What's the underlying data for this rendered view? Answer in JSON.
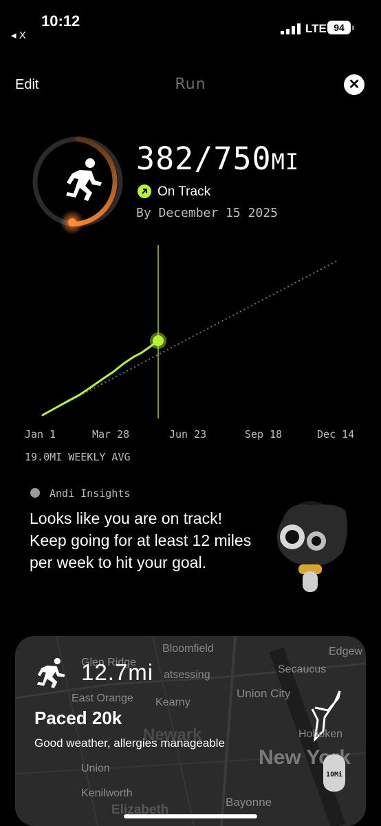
{
  "status_bar": {
    "time": "10:12",
    "back_app": "◂ X",
    "carrier": "LTE",
    "battery": "94"
  },
  "header": {
    "edit_label": "Edit",
    "title": "Run",
    "close_glyph": "✕"
  },
  "goal": {
    "current": "382",
    "target": "/750",
    "unit": "MI",
    "progress_fraction": 0.51,
    "status": "On Track",
    "deadline": "By December 15 2025"
  },
  "chart_data": {
    "type": "line",
    "x_ticks": [
      "Jan 1",
      "Mar 28",
      "Jun 23",
      "Sep 18",
      "Dec 14"
    ],
    "series": [
      {
        "values_fraction_of_year": [
          0.0,
          0.05,
          0.1,
          0.15,
          0.2,
          0.25,
          0.3,
          0.35,
          0.4,
          0.45
        ],
        "miles": [
          0,
          40,
          75,
          115,
          155,
          200,
          250,
          310,
          355,
          382
        ]
      }
    ],
    "projection_end_miles": 750,
    "today_marker": "today"
  },
  "weekly_avg": "19.0MI WEEKLY AVG",
  "insights": {
    "label": "Andi Insights",
    "text": "Looks like you are on track! Keep going for at least 12 miles per week to hit your goal."
  },
  "activity": {
    "distance": "12.7mi",
    "title": "Paced 20k",
    "subtitle": "Good weather, allergies manageable",
    "watch_label": "10Mi",
    "map_labels": [
      "Bloomfield",
      "Glen Ridge",
      "Edgew",
      "Secaucus",
      "atsessing",
      "East Orange",
      "Kearny",
      "Union City",
      "Newark",
      "Hoboken",
      "New York",
      "Union",
      "Kenilworth",
      "Bayonne",
      "Elizabeth"
    ]
  }
}
